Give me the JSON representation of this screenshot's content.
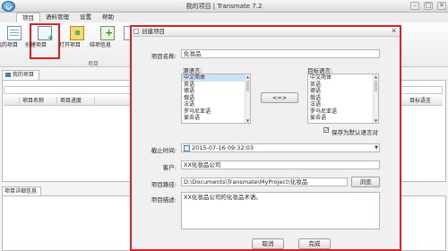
{
  "window": {
    "title": "我的项目 | Transmate 7.2"
  },
  "menu": {
    "items": [
      {
        "label": "项目"
      },
      {
        "label": "语料管理"
      },
      {
        "label": "设置"
      },
      {
        "label": "帮助"
      }
    ]
  },
  "ribbon": {
    "my_projects": "我的项目",
    "create_project": "创建项目",
    "open_project": "打开项目",
    "merge_info": "结项信息",
    "group_caption": "项目"
  },
  "projects": {
    "tab_label": "我的项目",
    "columns": {
      "name": "项目名称",
      "progress": "项目进度",
      "path": "目标语言"
    }
  },
  "details": {
    "tab_label": "项目详细信息"
  },
  "dialog": {
    "title": "创建项目",
    "project_name_label": "项目名称:",
    "project_name_value": "化妆品",
    "source_lang_label": "源语言:",
    "target_lang_label": "目标语言:",
    "languages": [
      "中文简体",
      "英语",
      "德语",
      "俄语",
      "法语",
      "罗马尼亚语",
      "爱去语"
    ],
    "source_selected": "中文简体",
    "swap_button": "<=>",
    "save_default_label": "保存为默认语言对",
    "deadline_label": "截止时间:",
    "deadline_value": "2015-07-16 09:32:03",
    "client_label": "客户:",
    "client_value": "XX化妆品公司",
    "path_label": "项目路径:",
    "path_value": "D:\\Documents\\Transmate\\MyProject\\化妆品",
    "browse_button": "浏览",
    "desc_label": "项目描述:",
    "desc_value": "XX化妆品公司的化妆品术语。",
    "cancel_button": "取消",
    "finish_button": "完成"
  }
}
